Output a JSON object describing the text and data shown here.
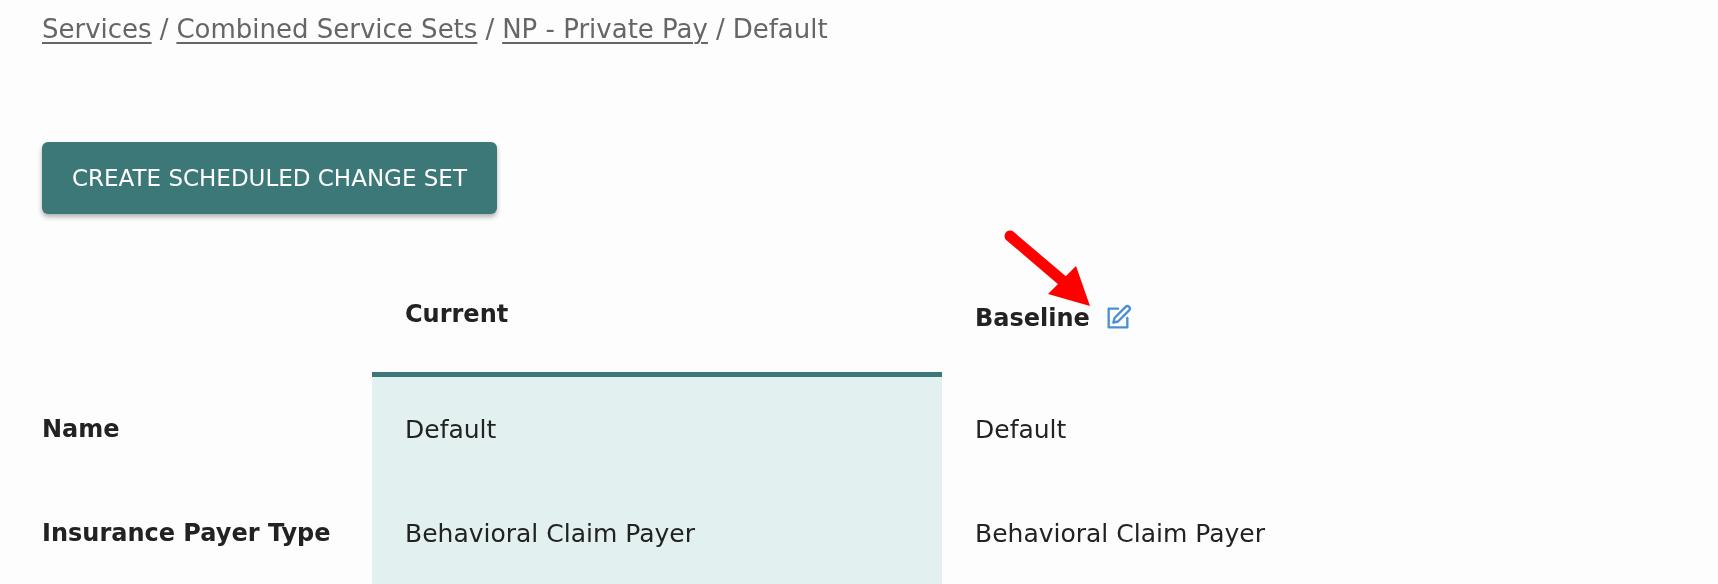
{
  "breadcrumb": [
    {
      "label": "Services",
      "kind": "link"
    },
    {
      "label": "Combined Service Sets",
      "kind": "link"
    },
    {
      "label": "NP - Private Pay",
      "kind": "link"
    },
    {
      "label": "Default",
      "kind": "current"
    }
  ],
  "breadcrumb_separator": "/",
  "action_button": {
    "label": "CREATE SCHEDULED CHANGE SET"
  },
  "table": {
    "columns": [
      {
        "label": "Current",
        "selected": true,
        "editable": false
      },
      {
        "label": "Baseline",
        "selected": false,
        "editable": true
      }
    ],
    "rows": [
      {
        "label": "Name",
        "values": [
          "Default",
          "Default"
        ]
      },
      {
        "label": "Insurance Payer Type",
        "values": [
          "Behavioral Claim Payer",
          "Behavioral Claim Payer"
        ]
      }
    ]
  }
}
